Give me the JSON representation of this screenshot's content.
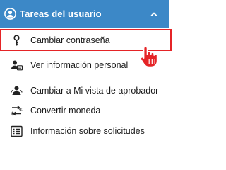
{
  "header": {
    "title": "Tareas del usuario",
    "icon": "user-circle-icon",
    "toggle_icon": "chevron-up-icon",
    "background": "#3c88c7"
  },
  "menu": {
    "items": [
      {
        "label": "Cambiar contraseña",
        "icon": "key-icon",
        "selected": true
      },
      {
        "label": "Ver información personal",
        "icon": "user-id-card-icon",
        "selected": false
      },
      {
        "label": "Cambiar a Mi vista de aprobador",
        "icon": "user-refresh-icon",
        "selected": false
      },
      {
        "label": "Convertir moneda",
        "icon": "currency-convert-icon",
        "selected": false
      },
      {
        "label": "Información sobre solicitudes",
        "icon": "list-icon",
        "selected": false
      }
    ]
  },
  "colors": {
    "selection_border": "#e52427",
    "cursor_fill": "#e52427"
  },
  "cursor": {
    "icon": "hand-pointer-icon"
  }
}
